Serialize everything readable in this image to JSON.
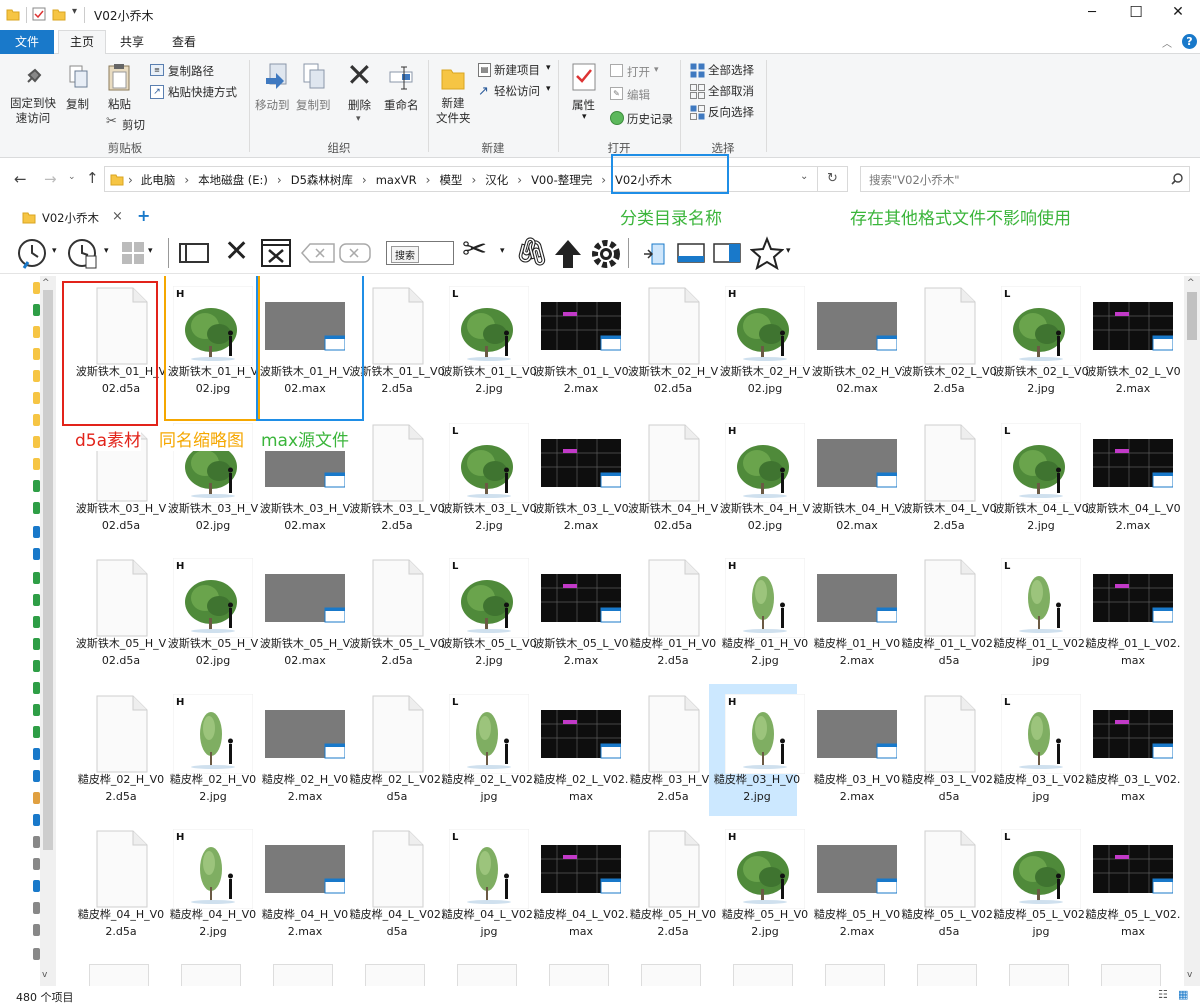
{
  "window": {
    "title": "V02小乔木",
    "minimize": "─",
    "maximize": "☐",
    "close": "✕"
  },
  "ribbon_tabs": [
    {
      "label": "文件",
      "active_file": true
    },
    {
      "label": "主页",
      "selected": true
    },
    {
      "label": "共享"
    },
    {
      "label": "查看"
    }
  ],
  "ribbon": {
    "pin": "固定到快\n速访问",
    "copy": "复制",
    "paste": "粘贴",
    "copy_path": "复制路径",
    "paste_shortcut": "粘贴快捷方式",
    "cut": "剪切",
    "group_clipboard": "剪贴板",
    "move_to": "移动到",
    "copy_to": "复制到",
    "delete": "删除",
    "rename": "重命名",
    "group_organize": "组织",
    "new_folder": "新建\n文件夹",
    "new_item": "新建项目",
    "easy_access": "轻松访问",
    "group_new": "新建",
    "properties": "属性",
    "open": "打开",
    "edit": "编辑",
    "history": "历史记录",
    "group_open": "打开",
    "select_all": "全部选择",
    "select_none": "全部取消",
    "invert_select": "反向选择",
    "group_select": "选择"
  },
  "address": {
    "crumbs": [
      "此电脑",
      "本地磁盘 (E:)",
      "D5森林树库",
      "maxVR",
      "模型",
      "汉化",
      "V00-整理完",
      "V02小乔木"
    ],
    "search_placeholder": "搜索\"V02小乔木\""
  },
  "annotations": {
    "category_name": "分类目录名称",
    "other_formats": "存在其他格式文件不影响使用",
    "d5a": "d5a素材",
    "thumb": "同名缩略图",
    "max": "max源文件"
  },
  "tab": {
    "label": "V02小乔木",
    "close": "×",
    "add": "+"
  },
  "toolbar": {
    "search_btn": "搜索"
  },
  "files": [
    [
      "波斯铁木_01_H_V02.d5a",
      "波斯铁木_01_H_V02.jpg",
      "波斯铁木_01_H_V02.max",
      "波斯铁木_01_L_V02.d5a",
      "波斯铁木_01_L_V02.jpg",
      "波斯铁木_01_L_V02.max",
      "波斯铁木_02_H_V02.d5a",
      "波斯铁木_02_H_V02.jpg",
      "波斯铁木_02_H_V02.max",
      "波斯铁木_02_L_V02.d5a",
      "波斯铁木_02_L_V02.jpg",
      "波斯铁木_02_L_V02.max"
    ],
    [
      "波斯铁木_03_H_V02.d5a",
      "波斯铁木_03_H_V02.jpg",
      "波斯铁木_03_H_V02.max",
      "波斯铁木_03_L_V02.d5a",
      "波斯铁木_03_L_V02.jpg",
      "波斯铁木_03_L_V02.max",
      "波斯铁木_04_H_V02.d5a",
      "波斯铁木_04_H_V02.jpg",
      "波斯铁木_04_H_V02.max",
      "波斯铁木_04_L_V02.d5a",
      "波斯铁木_04_L_V02.jpg",
      "波斯铁木_04_L_V02.max"
    ],
    [
      "波斯铁木_05_H_V02.d5a",
      "波斯铁木_05_H_V02.jpg",
      "波斯铁木_05_H_V02.max",
      "波斯铁木_05_L_V02.d5a",
      "波斯铁木_05_L_V02.jpg",
      "波斯铁木_05_L_V02.max",
      "糙皮桦_01_H_V02.d5a",
      "糙皮桦_01_H_V02.jpg",
      "糙皮桦_01_H_V02.max",
      "糙皮桦_01_L_V02.d5a",
      "糙皮桦_01_L_V02.jpg",
      "糙皮桦_01_L_V02.max"
    ],
    [
      "糙皮桦_02_H_V02.d5a",
      "糙皮桦_02_H_V02.jpg",
      "糙皮桦_02_H_V02.max",
      "糙皮桦_02_L_V02.d5a",
      "糙皮桦_02_L_V02.jpg",
      "糙皮桦_02_L_V02.max",
      "糙皮桦_03_H_V02.d5a",
      "糙皮桦_03_H_V02.jpg",
      "糙皮桦_03_H_V02.max",
      "糙皮桦_03_L_V02.d5a",
      "糙皮桦_03_L_V02.jpg",
      "糙皮桦_03_L_V02.max"
    ],
    [
      "糙皮桦_04_H_V02.d5a",
      "糙皮桦_04_H_V02.jpg",
      "糙皮桦_04_H_V02.max",
      "糙皮桦_04_L_V02.d5a",
      "糙皮桦_04_L_V02.jpg",
      "糙皮桦_04_L_V02.max",
      "糙皮桦_05_H_V02.d5a",
      "糙皮桦_05_H_V02.jpg",
      "糙皮桦_05_H_V02.max",
      "糙皮桦_05_L_V02.d5a",
      "糙皮桦_05_L_V02.jpg",
      "糙皮桦_05_L_V02.max"
    ]
  ],
  "selected_file": "糙皮桦_03_H_V02.jpg",
  "status": {
    "count": "480 个项目"
  },
  "colors": {
    "accent": "#1979ca",
    "annotation_green": "#3bb53b",
    "annotation_red": "#e2231a",
    "annotation_orange": "#f5a700",
    "annotation_blue": "#1f8ee6",
    "selection": "#cce8ff"
  }
}
